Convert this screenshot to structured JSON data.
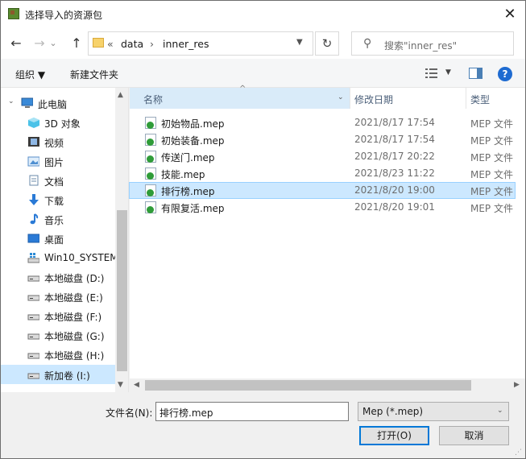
{
  "window": {
    "title": "选择导入的资源包",
    "close_glyph": "✕"
  },
  "nav": {
    "back": "←",
    "forward": "→",
    "history": "⌄",
    "up": "↑",
    "crumb_prefix": "«",
    "path": [
      "data",
      "inner_res"
    ],
    "separator": "›",
    "refresh": "↻",
    "search_placeholder": "搜索\"inner_res\""
  },
  "toolbar": {
    "organize": "组织 ▼",
    "new_folder": "新建文件夹"
  },
  "sidebar": {
    "items": [
      {
        "label": "此电脑",
        "icon": "computer-icon"
      },
      {
        "label": "3D 对象",
        "icon": "cube-3d-icon"
      },
      {
        "label": "视频",
        "icon": "video-icon"
      },
      {
        "label": "图片",
        "icon": "pictures-icon"
      },
      {
        "label": "文档",
        "icon": "documents-icon"
      },
      {
        "label": "下载",
        "icon": "download-icon"
      },
      {
        "label": "音乐",
        "icon": "music-icon"
      },
      {
        "label": "桌面",
        "icon": "desktop-icon"
      },
      {
        "label": "Win10_SYSTEM",
        "icon": "system-drive-icon"
      },
      {
        "label": "本地磁盘 (D:)",
        "icon": "drive-icon"
      },
      {
        "label": "本地磁盘 (E:)",
        "icon": "drive-icon"
      },
      {
        "label": "本地磁盘 (F:)",
        "icon": "drive-icon"
      },
      {
        "label": "本地磁盘 (G:)",
        "icon": "drive-icon"
      },
      {
        "label": "本地磁盘 (H:)",
        "icon": "drive-icon"
      },
      {
        "label": "新加卷 (I:)",
        "icon": "drive-icon",
        "selected": true
      }
    ]
  },
  "columns": {
    "name": "名称",
    "date": "修改日期",
    "type": "类型"
  },
  "files": [
    {
      "name": "初始物品.mep",
      "date": "2021/8/17 17:54",
      "type": "MEP 文件"
    },
    {
      "name": "初始装备.mep",
      "date": "2021/8/17 17:54",
      "type": "MEP 文件"
    },
    {
      "name": "传送门.mep",
      "date": "2021/8/17 20:22",
      "type": "MEP 文件"
    },
    {
      "name": "技能.mep",
      "date": "2021/8/23 11:22",
      "type": "MEP 文件"
    },
    {
      "name": "排行榜.mep",
      "date": "2021/8/20 19:00",
      "type": "MEP 文件",
      "selected": true
    },
    {
      "name": "有限复活.mep",
      "date": "2021/8/20 19:01",
      "type": "MEP 文件"
    }
  ],
  "footer": {
    "filename_label": "文件名(N):",
    "filename_value": "排行榜.mep",
    "filetype_value": "Mep (*.mep)",
    "open_label": "打开(O)",
    "cancel_label": "取消"
  },
  "colors": {
    "selection": "#cce8ff",
    "accent": "#0078d7",
    "file_badge": "#2f9c39"
  }
}
